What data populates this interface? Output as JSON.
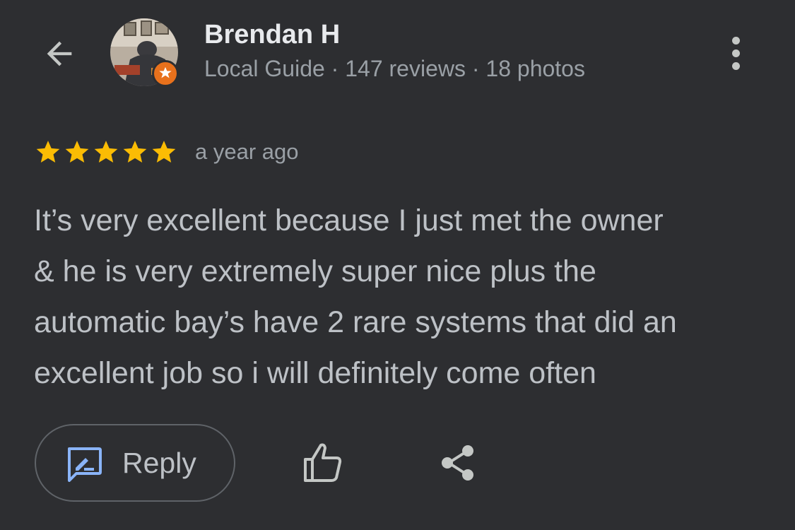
{
  "header": {
    "reviewer_name": "Brendan H",
    "reviewer_meta": "Local Guide · 147 reviews · 18 photos"
  },
  "icons": {
    "back": "arrow-back-icon",
    "more": "more-vert-icon",
    "badge": "local-guide-badge-icon",
    "reply": "rate-review-icon",
    "like": "thumb-up-outline-icon",
    "share": "share-icon"
  },
  "review": {
    "rating": 5,
    "max_rating": 5,
    "time": "a year ago",
    "text_lines": [
      "It’s very excellent because I just met the owner",
      "& he is very extremely super nice plus the",
      "automatic bay’s have 2 rare systems that did an",
      "excellent job so i will definitely come often"
    ]
  },
  "actions": {
    "reply_label": "Reply"
  },
  "colors": {
    "background": "#2d2e31",
    "star": "#fbbc04",
    "primary_text": "#e8eaed",
    "secondary_text": "#9aa0a6",
    "body_text": "#bdc1c6",
    "reply_icon": "#8ab4f8",
    "badge": "#e8711c"
  }
}
